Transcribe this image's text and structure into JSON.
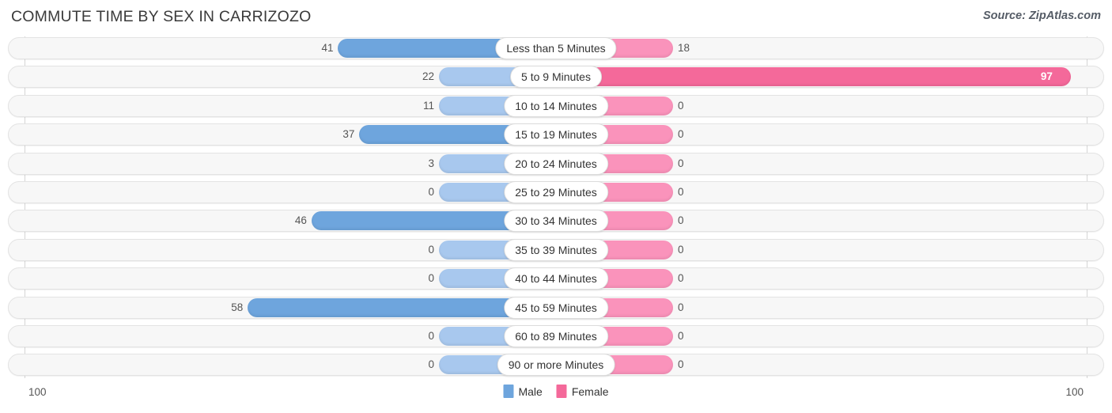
{
  "header": {
    "title": "COMMUTE TIME BY SEX IN CARRIZOZO",
    "source": "Source: ZipAtlas.com"
  },
  "legend": {
    "male_label": "Male",
    "female_label": "Female",
    "male_color": "#6ea5dd",
    "female_color": "#f4699a"
  },
  "axis": {
    "left_label": "100",
    "right_label": "100",
    "max": 100
  },
  "colors": {
    "male_strong": "#6ea5dd",
    "male_light": "#a8c8ee",
    "female_strong": "#f4699a",
    "female_light": "#fa93bb"
  },
  "chart_data": {
    "type": "bar",
    "title": "COMMUTE TIME BY SEX IN CARRIZOZO",
    "subtitle": "Source: ZipAtlas.com",
    "orientation": "horizontal-diverging",
    "xlabel": "",
    "ylabel": "",
    "xlim": [
      100,
      100
    ],
    "grid": false,
    "legend_position": "bottom-center",
    "categories": [
      "Less than 5 Minutes",
      "5 to 9 Minutes",
      "10 to 14 Minutes",
      "15 to 19 Minutes",
      "20 to 24 Minutes",
      "25 to 29 Minutes",
      "30 to 34 Minutes",
      "35 to 39 Minutes",
      "40 to 44 Minutes",
      "45 to 59 Minutes",
      "60 to 89 Minutes",
      "90 or more Minutes"
    ],
    "series": [
      {
        "name": "Male",
        "color": "#6ea5dd",
        "values": [
          41,
          22,
          11,
          37,
          3,
          0,
          46,
          0,
          0,
          58,
          0,
          0
        ]
      },
      {
        "name": "Female",
        "color": "#f4699a",
        "values": [
          18,
          97,
          0,
          0,
          0,
          0,
          0,
          0,
          0,
          0,
          0,
          0
        ]
      }
    ]
  },
  "rows": [
    {
      "label": "Less than 5 Minutes",
      "male": "41",
      "female": "18"
    },
    {
      "label": "5 to 9 Minutes",
      "male": "22",
      "female": "97"
    },
    {
      "label": "10 to 14 Minutes",
      "male": "11",
      "female": "0"
    },
    {
      "label": "15 to 19 Minutes",
      "male": "37",
      "female": "0"
    },
    {
      "label": "20 to 24 Minutes",
      "male": "3",
      "female": "0"
    },
    {
      "label": "25 to 29 Minutes",
      "male": "0",
      "female": "0"
    },
    {
      "label": "30 to 34 Minutes",
      "male": "46",
      "female": "0"
    },
    {
      "label": "35 to 39 Minutes",
      "male": "0",
      "female": "0"
    },
    {
      "label": "40 to 44 Minutes",
      "male": "0",
      "female": "0"
    },
    {
      "label": "45 to 59 Minutes",
      "male": "58",
      "female": "0"
    },
    {
      "label": "60 to 89 Minutes",
      "male": "0",
      "female": "0"
    },
    {
      "label": "90 or more Minutes",
      "male": "0",
      "female": "0"
    }
  ]
}
